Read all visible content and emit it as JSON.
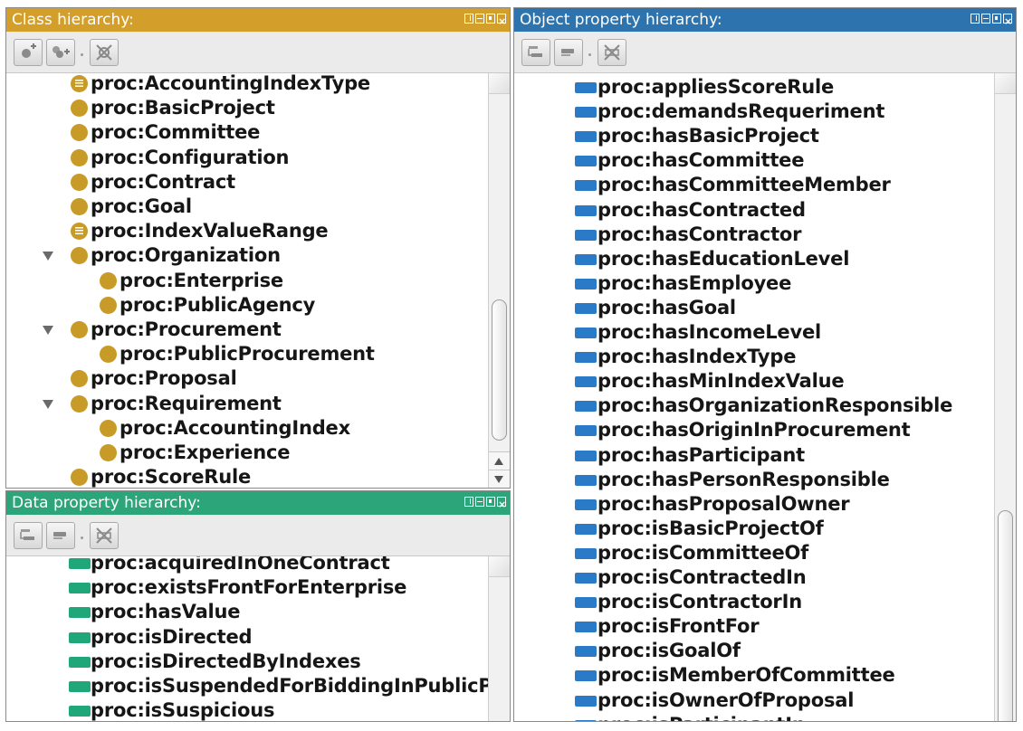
{
  "colors": {
    "class_title_bg": "#d39e29",
    "data_title_bg": "#2da57a",
    "object_title_bg": "#2d73ad",
    "class_icon": "#c89b29",
    "data_icon": "#1fa77a",
    "object_icon": "#2b7ac7"
  },
  "class_panel": {
    "title": "Class hierarchy:",
    "toolbar_icons": [
      "add-subclass-icon",
      "add-sibling-class-icon",
      "delete-class-icon"
    ],
    "items": [
      {
        "label": "proc:AccountingIndexType",
        "icon": "enumerated-class-icon"
      },
      {
        "label": "proc:BasicProject",
        "icon": "class-icon"
      },
      {
        "label": "proc:Committee",
        "icon": "class-icon"
      },
      {
        "label": "proc:Configuration",
        "icon": "class-icon"
      },
      {
        "label": "proc:Contract",
        "icon": "class-icon"
      },
      {
        "label": "proc:Goal",
        "icon": "class-icon"
      },
      {
        "label": "proc:IndexValueRange",
        "icon": "enumerated-class-icon"
      },
      {
        "label": "proc:Organization",
        "icon": "class-icon",
        "expanded": true
      },
      {
        "label": "proc:Enterprise",
        "icon": "class-icon",
        "child": true
      },
      {
        "label": "proc:PublicAgency",
        "icon": "class-icon",
        "child": true
      },
      {
        "label": "proc:Procurement",
        "icon": "class-icon",
        "expanded": true
      },
      {
        "label": "proc:PublicProcurement",
        "icon": "class-icon",
        "child": true
      },
      {
        "label": "proc:Proposal",
        "icon": "class-icon"
      },
      {
        "label": "proc:Requirement",
        "icon": "class-icon",
        "expanded": true
      },
      {
        "label": "proc:AccountingIndex",
        "icon": "class-icon",
        "child": true
      },
      {
        "label": "proc:Experience",
        "icon": "class-icon",
        "child": true
      },
      {
        "label": "proc:ScoreRule",
        "icon": "class-icon"
      }
    ]
  },
  "data_panel": {
    "title": "Data property hierarchy:",
    "toolbar_icons": [
      "add-subproperty-icon",
      "add-sibling-property-icon",
      "delete-property-icon"
    ],
    "items": [
      {
        "label": "proc:acquiredInOneContract"
      },
      {
        "label": "proc:existsFrontForEnterprise"
      },
      {
        "label": "proc:hasValue"
      },
      {
        "label": "proc:isDirected"
      },
      {
        "label": "proc:isDirectedByIndexes"
      },
      {
        "label": "proc:isSuspendedForBiddingInPublicP"
      },
      {
        "label": "proc:isSuspicious"
      }
    ]
  },
  "object_panel": {
    "title": "Object property hierarchy:",
    "toolbar_icons": [
      "add-subproperty-icon",
      "add-sibling-property-icon",
      "delete-property-icon"
    ],
    "items": [
      {
        "label": "proc:appliesScoreRule"
      },
      {
        "label": "proc:demandsRequeriment"
      },
      {
        "label": "proc:hasBasicProject"
      },
      {
        "label": "proc:hasCommittee"
      },
      {
        "label": "proc:hasCommitteeMember"
      },
      {
        "label": "proc:hasContracted"
      },
      {
        "label": "proc:hasContractor"
      },
      {
        "label": "proc:hasEducationLevel"
      },
      {
        "label": "proc:hasEmployee"
      },
      {
        "label": "proc:hasGoal"
      },
      {
        "label": "proc:hasIncomeLevel"
      },
      {
        "label": "proc:hasIndexType"
      },
      {
        "label": "proc:hasMinIndexValue"
      },
      {
        "label": "proc:hasOrganizationResponsible"
      },
      {
        "label": "proc:hasOriginInProcurement"
      },
      {
        "label": "proc:hasParticipant"
      },
      {
        "label": "proc:hasPersonResponsible"
      },
      {
        "label": "proc:hasProposalOwner"
      },
      {
        "label": "proc:isBasicProjectOf"
      },
      {
        "label": "proc:isCommitteeOf"
      },
      {
        "label": "proc:isContractedIn"
      },
      {
        "label": "proc:isContractorIn"
      },
      {
        "label": "proc:isFrontFor"
      },
      {
        "label": "proc:isGoalOf"
      },
      {
        "label": "proc:isMemberOfCommittee"
      },
      {
        "label": "proc:isOwnerOfProposal"
      },
      {
        "label": "proc:isParticipantIn"
      }
    ]
  }
}
